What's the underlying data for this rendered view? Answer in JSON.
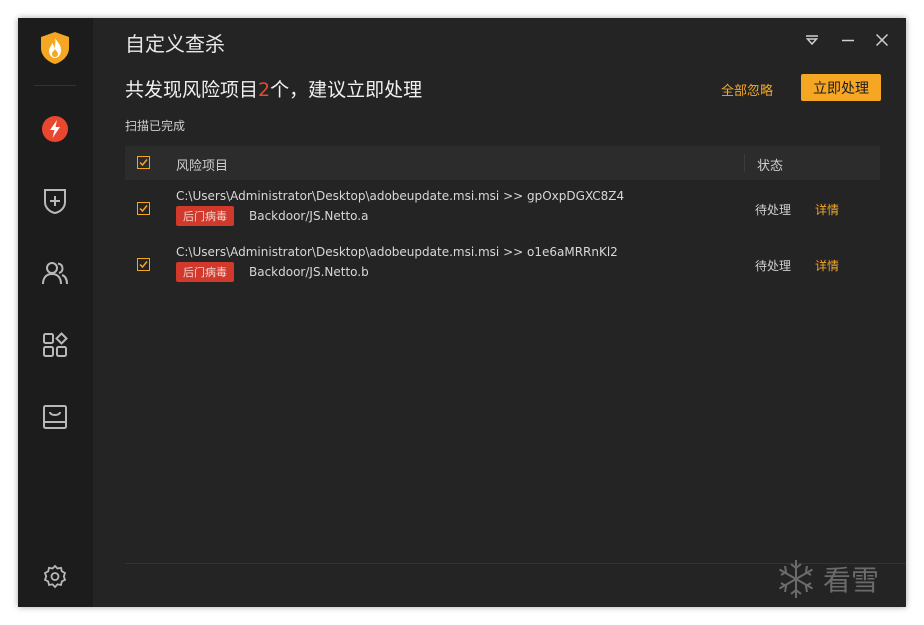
{
  "window": {
    "title": "自定义查杀"
  },
  "sidebar": {
    "items": [
      {
        "name": "virus-scan",
        "icon": "lightning-icon",
        "active": true
      },
      {
        "name": "protection",
        "icon": "shield-plus-icon"
      },
      {
        "name": "users",
        "icon": "users-icon"
      },
      {
        "name": "tools",
        "icon": "apps-grid-icon"
      },
      {
        "name": "box",
        "icon": "box-icon"
      }
    ],
    "settings_icon": "gear-icon"
  },
  "summary": {
    "prefix": "共发现风险项目",
    "count": "2",
    "suffix": "个，建议立即处理",
    "status": "扫描已完成",
    "ignore_all": "全部忽略",
    "handle_now": "立即处理"
  },
  "table": {
    "col_item": "风险项目",
    "col_status": "状态",
    "rows": [
      {
        "path": "C:\\Users\\Administrator\\Desktop\\adobeupdate.msi.msi >> gpOxpDGXC8Z4",
        "tag": "后门病毒",
        "threat": "Backdoor/JS.Netto.a",
        "status": "待处理",
        "detail": "详情"
      },
      {
        "path": "C:\\Users\\Administrator\\Desktop\\adobeupdate.msi.msi >> o1e6aMRRnKl2",
        "tag": "后门病毒",
        "threat": "Backdoor/JS.Netto.b",
        "status": "待处理",
        "detail": "详情"
      }
    ]
  },
  "watermark": {
    "text": "看雪"
  },
  "colors": {
    "accent": "#f5a623",
    "danger": "#e9472f",
    "background": "#242424",
    "sidebar": "#1c1c1c"
  }
}
